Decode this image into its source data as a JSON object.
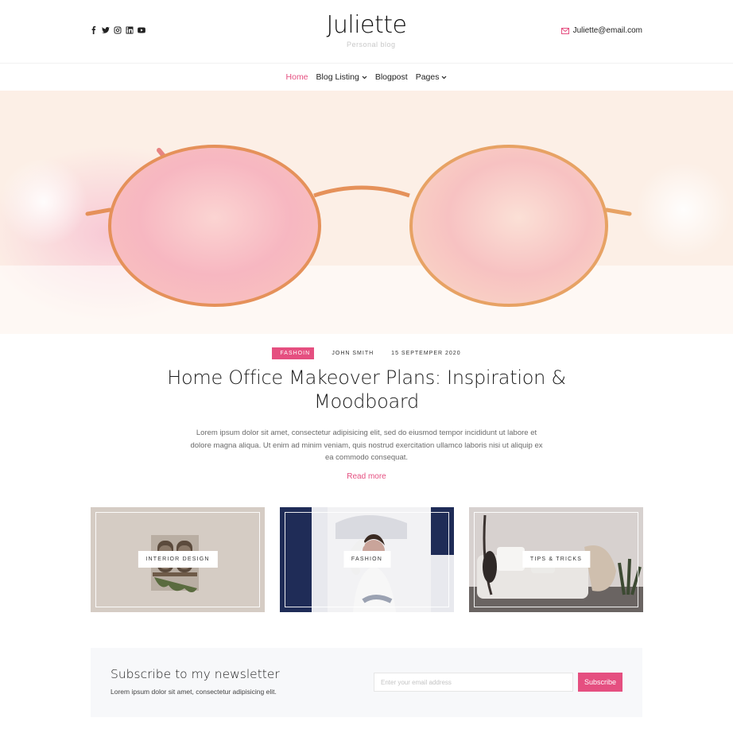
{
  "header": {
    "logo": "Juliette",
    "tagline": "Personal blog",
    "email": "Juliette@email.com",
    "social": [
      "facebook-icon",
      "twitter-icon",
      "instagram-icon",
      "linkedin-icon",
      "youtube-icon"
    ]
  },
  "nav": {
    "items": [
      {
        "label": "Home",
        "active": true
      },
      {
        "label": "Blog Listing",
        "dropdown": true
      },
      {
        "label": "Blogpost"
      },
      {
        "label": "Pages",
        "dropdown": true
      }
    ]
  },
  "featured": {
    "category": "FASHOIN",
    "author": "JOHN SMITH",
    "date": "15 SEPTEMPER 2020",
    "title": "Home Office Makeover Plans: Inspiration & Moodboard",
    "excerpt": "Lorem ipsum dolor sit amet, consectetur adipisicing elit, sed do eiusmod tempor incididunt ut labore et dolore magna aliqua. Ut enim ad minim veniam, quis nostrud exercitation ullamco laboris nisi ut aliquip ex ea commodo consequat.",
    "read_more": "Read more"
  },
  "categories": [
    {
      "label": "INTERIOR DESIGN"
    },
    {
      "label": "FASHION"
    },
    {
      "label": "TIPS & TRICKS"
    }
  ],
  "newsletter": {
    "heading": "Subscribe to my newsletter",
    "text": "Lorem ipsum dolor sit amet, consectetur adipisicing elit.",
    "placeholder": "Enter your email address",
    "button": "Subscribe"
  },
  "colors": {
    "accent": "#e54f80",
    "newsletter_bg": "#f7f8fa"
  }
}
